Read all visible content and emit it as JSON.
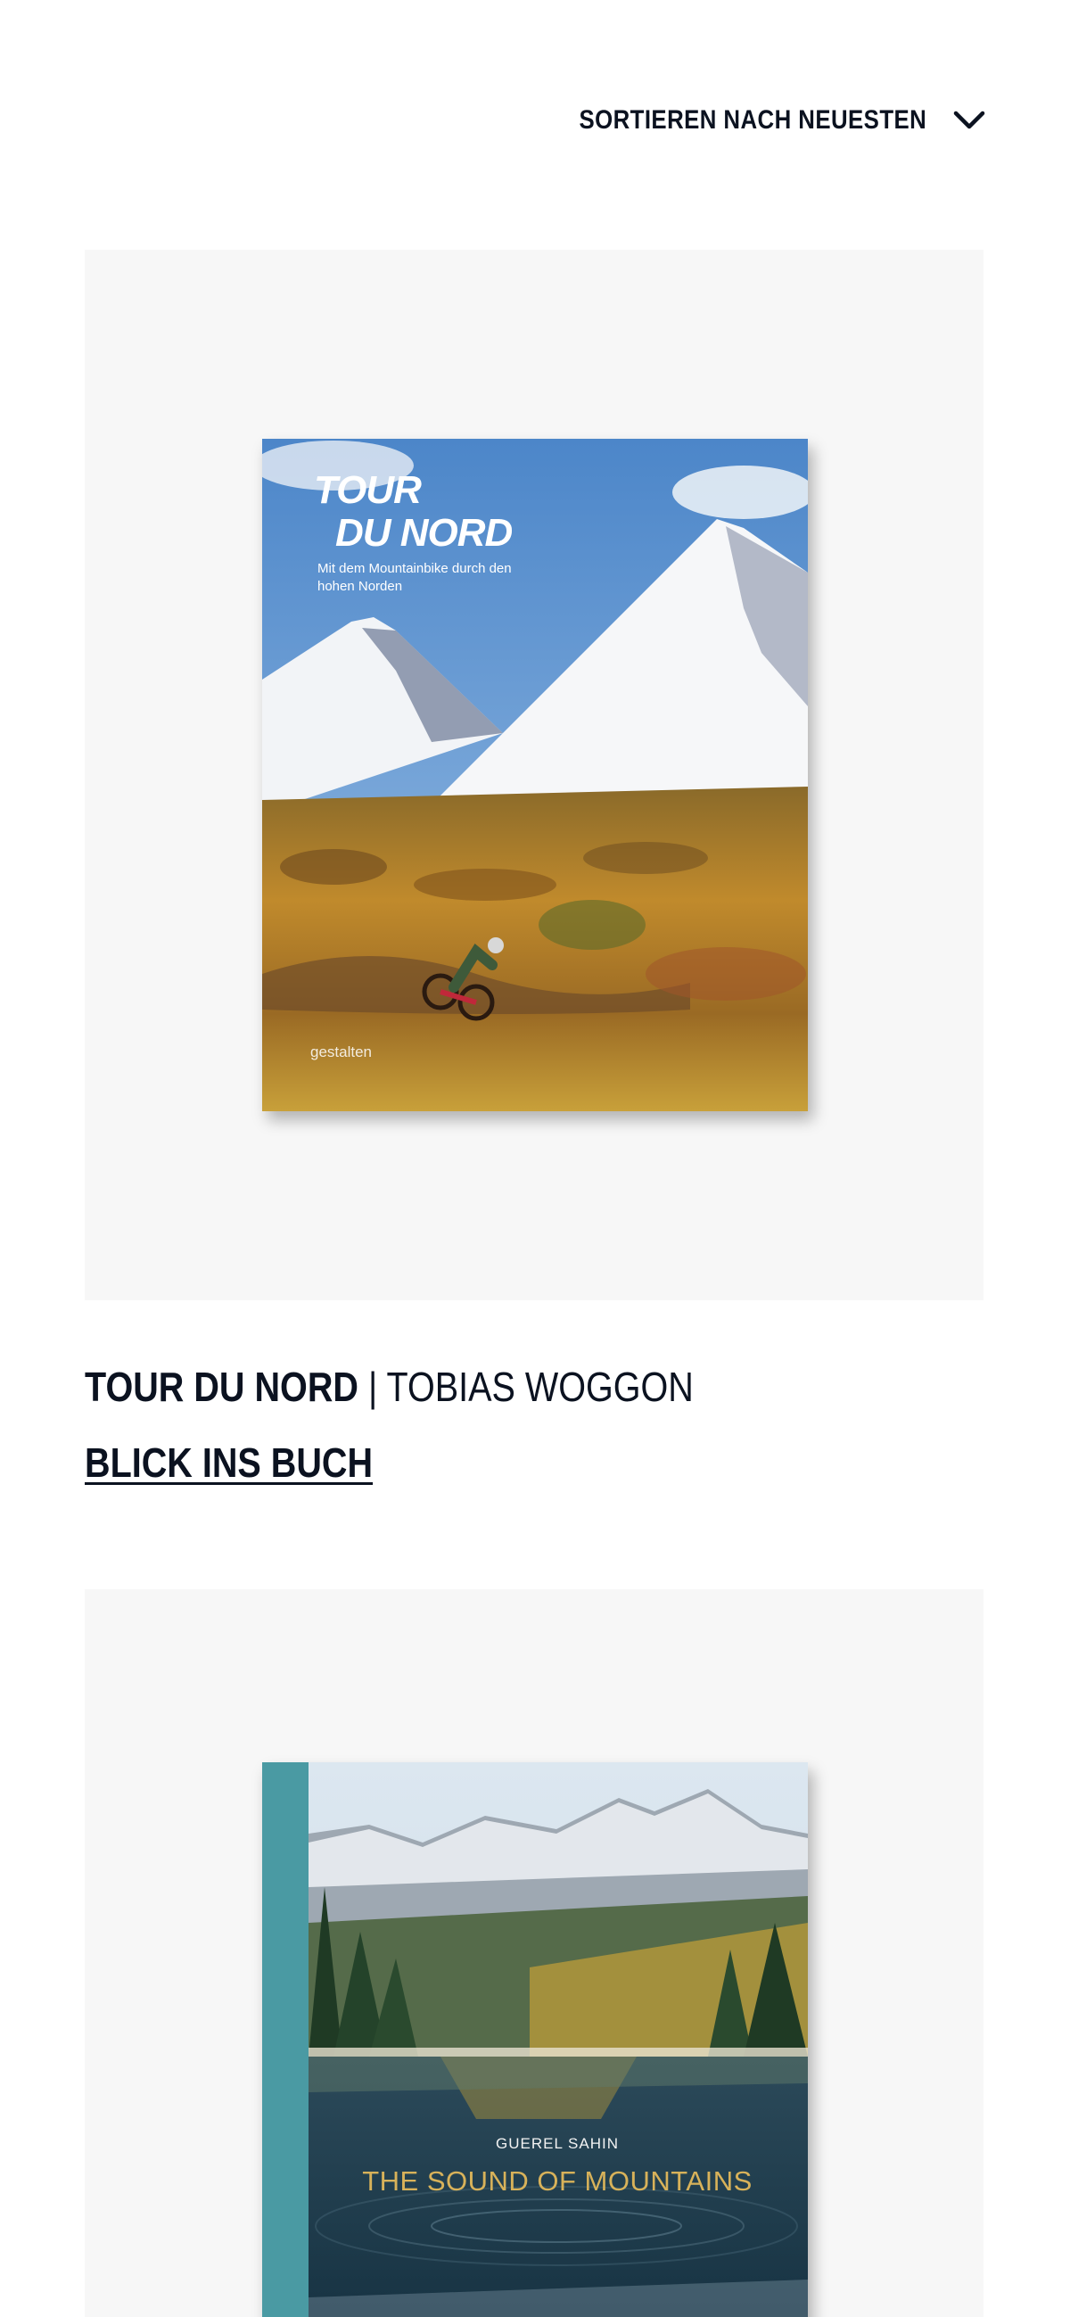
{
  "sort": {
    "label": "SORTIEREN NACH NEUESTEN",
    "icon": "chevron-down-icon"
  },
  "books": [
    {
      "cover": {
        "title_line1": "TOUR",
        "title_line2": "DU NORD",
        "subtitle": "Mit dem Mountainbike durch den hohen Norden",
        "publisher": "gestalten"
      },
      "title": "TOUR DU NORD",
      "separator": " | ",
      "author": "TOBIAS WOGGON",
      "link_label": "BLICK INS BUCH"
    },
    {
      "cover": {
        "author": "GUEREL SAHIN",
        "title": "THE SOUND OF MOUNTAINS"
      }
    }
  ],
  "colors": {
    "text": "#0b1220",
    "card_background": "#f7f7f7",
    "cover2_spine": "#4a9aa3",
    "cover2_title": "#d8b25a"
  }
}
